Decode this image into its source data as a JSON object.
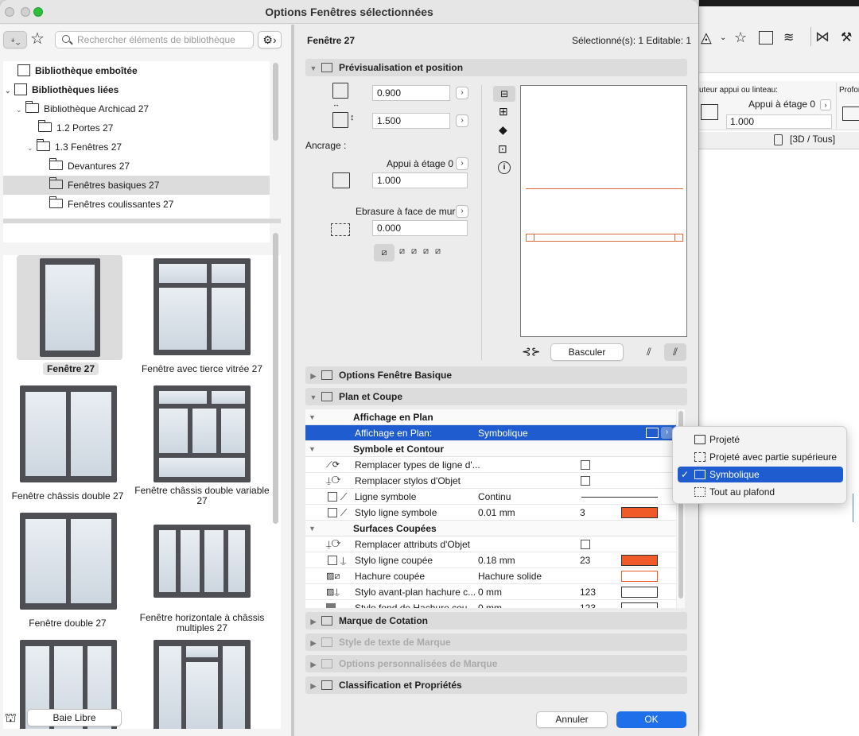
{
  "window": {
    "title": "Options Fenêtres sélectionnées"
  },
  "library": {
    "search_placeholder": "Rechercher éléments de bibliothèque",
    "tree": [
      {
        "label": "Bibliothèque emboîtée"
      },
      {
        "label": "Bibliothèques liées"
      },
      {
        "label": "Bibliothèque Archicad 27"
      },
      {
        "label": "1.2 Portes 27"
      },
      {
        "label": "1.3 Fenêtres 27"
      },
      {
        "label": "Devantures 27"
      },
      {
        "label": "Fenêtres basiques 27"
      },
      {
        "label": "Fenêtres coulissantes 27"
      }
    ],
    "items": [
      {
        "label": "Fenêtre 27"
      },
      {
        "label": "Fenêtre avec tierce vitrée 27"
      },
      {
        "label": "Fenêtre châssis double 27"
      },
      {
        "label": "Fenêtre châssis double variable 27"
      },
      {
        "label": "Fenêtre double 27"
      },
      {
        "label": "Fenêtre horizontale à châssis multiples 27"
      },
      {
        "label": ""
      },
      {
        "label": ""
      }
    ],
    "footer_button": "Baie Libre"
  },
  "settings": {
    "name": "Fenêtre 27",
    "selection": "Sélectionné(s): 1 Editable: 1",
    "preview": {
      "title": "Prévisualisation et position",
      "width": "0.900",
      "height": "1.500",
      "anchor_label": "Ancrage :",
      "anchor_ref": "Appui à étage 0",
      "anchor_value": "1.000",
      "reveal_ref": "Ebrasure à face de mur",
      "reveal_value": "0.000",
      "flip_button": "Basculer"
    },
    "sections": {
      "basic": "Options Fenêtre Basique",
      "plan": "Plan et Coupe",
      "dimension": "Marque de Cotation",
      "text_style": "Style de texte de Marque",
      "custom": "Options personnalisées de Marque",
      "classification": "Classification et Propriétés"
    },
    "plan": {
      "group1": "Affichage en Plan",
      "selected_row": {
        "label": "Affichage en Plan:",
        "value": "Symbolique"
      },
      "group2": "Symbole et Contour",
      "rows2": [
        {
          "label": "Remplacer types de ligne d'...",
          "value": "",
          "num": ""
        },
        {
          "label": "Remplacer stylos d'Objet",
          "value": "",
          "num": ""
        },
        {
          "label": "Ligne symbole",
          "value": "Continu",
          "num": ""
        },
        {
          "label": "Stylo ligne symbole",
          "value": "0.01 mm",
          "num": "3"
        }
      ],
      "group3": "Surfaces Coupées",
      "rows3": [
        {
          "label": "Remplacer attributs d'Objet",
          "value": "",
          "num": ""
        },
        {
          "label": "Stylo ligne coupée",
          "value": "0.18 mm",
          "num": "23"
        },
        {
          "label": "Hachure coupée",
          "value": "Hachure solide",
          "num": ""
        },
        {
          "label": "Stylo avant-plan hachure c...",
          "value": "0 mm",
          "num": "123"
        },
        {
          "label": "Stylo fond de Hachure cou...",
          "value": "0 mm",
          "num": "123"
        }
      ]
    },
    "buttons": {
      "cancel": "Annuler",
      "ok": "OK"
    },
    "accent": "#1f5ccf",
    "swatch_color": "#f05a28"
  },
  "dropdown": {
    "options": [
      {
        "label": "Projeté",
        "checked": ""
      },
      {
        "label": "Projeté avec partie supérieure",
        "checked": ""
      },
      {
        "label": "Symbolique",
        "checked": "✓"
      },
      {
        "label": "Tout au plafond",
        "checked": ""
      }
    ]
  },
  "background_app": {
    "label_height": "uteur appui ou linteau:",
    "label_depth": "Profon",
    "ref": "Appui à étage 0",
    "value": "1.000",
    "view": "[3D / Tous]"
  }
}
